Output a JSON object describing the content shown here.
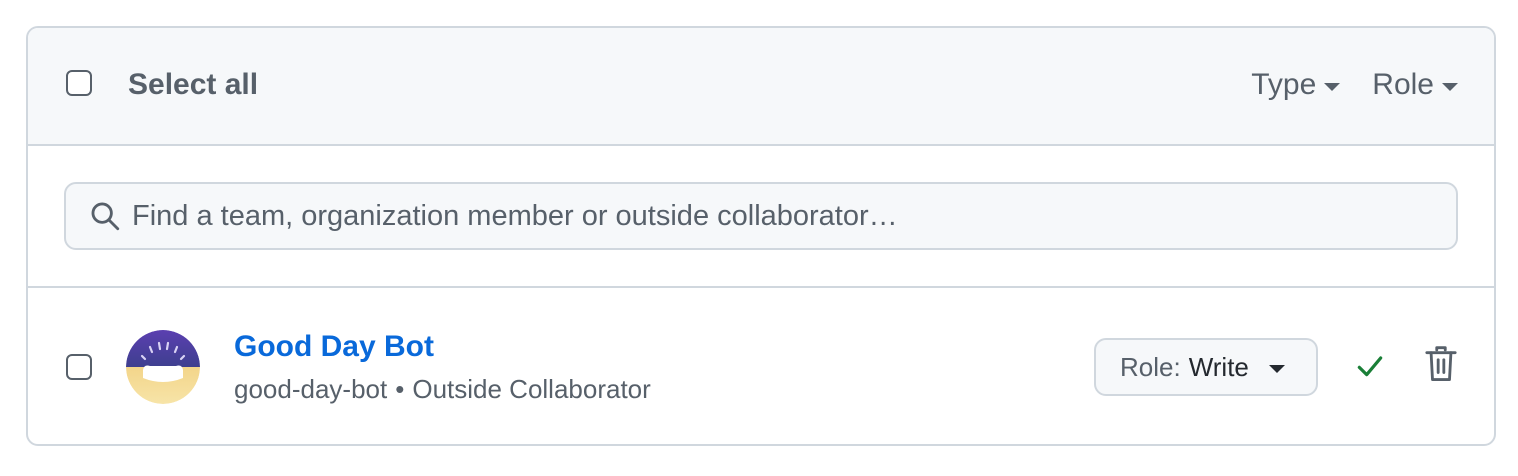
{
  "header": {
    "select_all_label": "Select all",
    "filters": [
      {
        "label": "Type"
      },
      {
        "label": "Role"
      }
    ]
  },
  "search": {
    "placeholder": "Find a team, organization member or outside collaborator…",
    "value": ""
  },
  "members": [
    {
      "name": "Good Day Bot",
      "username": "good-day-bot",
      "separator": "•",
      "type": "Outside Collaborator",
      "role_prefix": "Role:",
      "role_value": "Write",
      "status_icon": "check-icon",
      "action_icon": "trash-icon"
    }
  ],
  "colors": {
    "link": "#0969da",
    "success": "#1a7f37",
    "border": "#d0d7de",
    "header_bg": "#f6f8fa",
    "muted_text": "#57606a"
  }
}
